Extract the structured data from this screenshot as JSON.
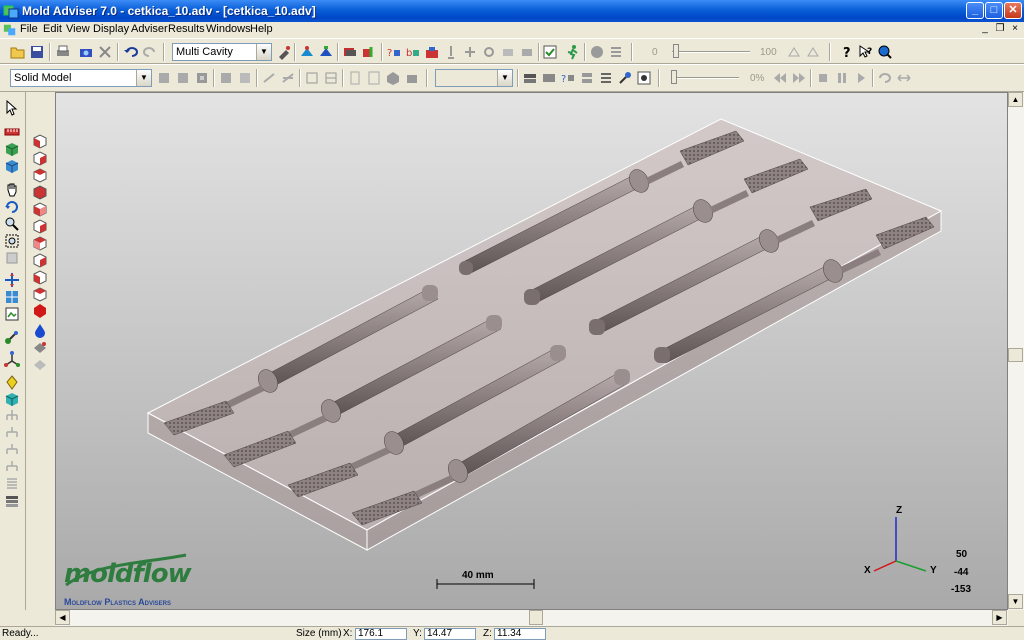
{
  "window": {
    "title": "Mold Adviser 7.0 - cetkica_10.adv - [cetkica_10.adv]",
    "minimize": "_",
    "maximize": "□",
    "close": "✕"
  },
  "menu": {
    "items": [
      "File",
      "Edit",
      "View",
      "Display",
      "Adviser",
      "Results",
      "Windows",
      "Help"
    ],
    "mdi_minimize": "_",
    "mdi_restore": "❐",
    "mdi_close": "×"
  },
  "toolbar1": {
    "cavity_select": "Multi Cavity",
    "slider_min": "0",
    "slider_max": "100"
  },
  "toolbar2": {
    "model_select": "Solid Model",
    "empty_select": "",
    "progress_label": "0%"
  },
  "viewport": {
    "scale_label": "40 mm",
    "axis": {
      "z": "Z",
      "x": "X",
      "y": "Y"
    },
    "rotation": [
      "50",
      "-44",
      "-153"
    ],
    "logo_text": "moldflow",
    "logo_subtitle": "Moldflow Plastics Advisers"
  },
  "statusbar": {
    "ready": "Ready...",
    "size_label": "Size (mm)",
    "x_label": "X:",
    "x_value": "176.1",
    "y_label": "Y:",
    "y_value": "14.47",
    "z_label": "Z:",
    "z_value": "11.34"
  },
  "icons": {
    "toolbar1": [
      "open-icon",
      "save-icon",
      "print-icon",
      "camera-icon",
      "delete-icon",
      "undo-icon",
      "redo-icon",
      "pick-icon",
      "import-icon",
      "mesh-icon",
      "cavity-icon",
      "gate-icon",
      "runner-icon",
      "cooling-icon",
      "analysis-icon",
      "check-icon",
      "run-icon",
      "sphere-icon",
      "filter-icon",
      "help-icon",
      "whats-this-icon",
      "zoom-icon"
    ],
    "left": [
      "select-icon",
      "ruler-icon",
      "cube-green-icon",
      "cube-blue-icon",
      "pan-icon",
      "rotate-icon",
      "zoom-icon",
      "window-zoom-icon",
      "fit-icon",
      "center-icon",
      "measure-icon",
      "layers-icon",
      "light-icon",
      "mesh-icon",
      "axis-icon",
      "locate-icon",
      "cube-cyan-icon",
      "tree-icon",
      "stack-icon"
    ]
  },
  "colors": {
    "accent": "#0a5fd8",
    "chrome": "#ece9d8",
    "part": "#8a7e7e",
    "mold_block": "#b9a5a5",
    "logo": "#2e7d3e"
  }
}
